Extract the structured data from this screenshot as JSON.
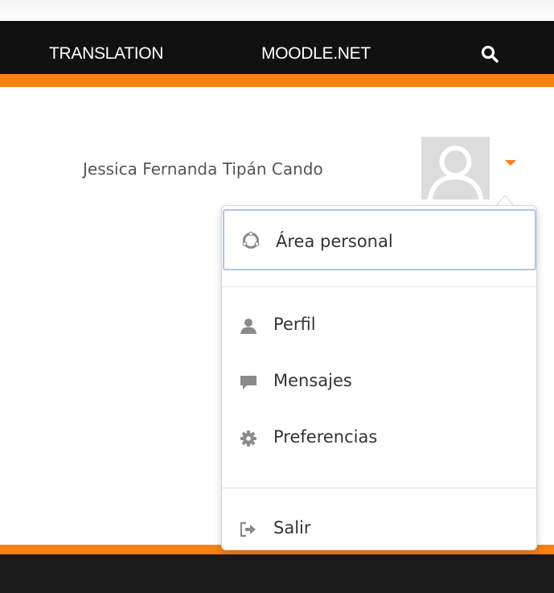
{
  "navbar": {
    "items": [
      {
        "label": "TRANSLATION"
      },
      {
        "label": "MOODLE.NET"
      }
    ],
    "search_icon": "search-icon",
    "bar_color": "#111111",
    "accent_color": "#f98012"
  },
  "user": {
    "name": "Jessica Fernanda Tipán Cando",
    "avatar_icon": "default-avatar-icon",
    "caret_icon": "caret-down-icon"
  },
  "user_menu": {
    "items": [
      {
        "label": "Área personal",
        "icon": "dashboard-icon"
      },
      {
        "label": "Perfil",
        "icon": "user-icon"
      },
      {
        "label": "Mensajes",
        "icon": "comment-icon"
      },
      {
        "label": "Preferencias",
        "icon": "gear-icon"
      },
      {
        "label": "Salir",
        "icon": "sign-out-icon"
      }
    ]
  }
}
